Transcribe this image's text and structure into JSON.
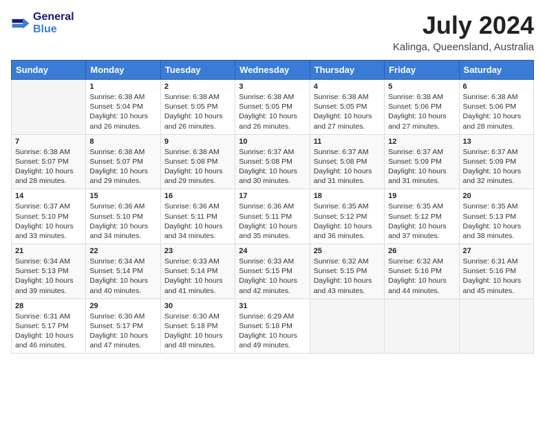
{
  "header": {
    "logo_line1": "General",
    "logo_line2": "Blue",
    "month_year": "July 2024",
    "location": "Kalinga, Queensland, Australia"
  },
  "days_of_week": [
    "Sunday",
    "Monday",
    "Tuesday",
    "Wednesday",
    "Thursday",
    "Friday",
    "Saturday"
  ],
  "weeks": [
    [
      {
        "day": "",
        "info": ""
      },
      {
        "day": "1",
        "info": "Sunrise: 6:38 AM\nSunset: 5:04 PM\nDaylight: 10 hours\nand 26 minutes."
      },
      {
        "day": "2",
        "info": "Sunrise: 6:38 AM\nSunset: 5:05 PM\nDaylight: 10 hours\nand 26 minutes."
      },
      {
        "day": "3",
        "info": "Sunrise: 6:38 AM\nSunset: 5:05 PM\nDaylight: 10 hours\nand 26 minutes."
      },
      {
        "day": "4",
        "info": "Sunrise: 6:38 AM\nSunset: 5:05 PM\nDaylight: 10 hours\nand 27 minutes."
      },
      {
        "day": "5",
        "info": "Sunrise: 6:38 AM\nSunset: 5:06 PM\nDaylight: 10 hours\nand 27 minutes."
      },
      {
        "day": "6",
        "info": "Sunrise: 6:38 AM\nSunset: 5:06 PM\nDaylight: 10 hours\nand 28 minutes."
      }
    ],
    [
      {
        "day": "7",
        "info": "Sunrise: 6:38 AM\nSunset: 5:07 PM\nDaylight: 10 hours\nand 28 minutes."
      },
      {
        "day": "8",
        "info": "Sunrise: 6:38 AM\nSunset: 5:07 PM\nDaylight: 10 hours\nand 29 minutes."
      },
      {
        "day": "9",
        "info": "Sunrise: 6:38 AM\nSunset: 5:08 PM\nDaylight: 10 hours\nand 29 minutes."
      },
      {
        "day": "10",
        "info": "Sunrise: 6:37 AM\nSunset: 5:08 PM\nDaylight: 10 hours\nand 30 minutes."
      },
      {
        "day": "11",
        "info": "Sunrise: 6:37 AM\nSunset: 5:08 PM\nDaylight: 10 hours\nand 31 minutes."
      },
      {
        "day": "12",
        "info": "Sunrise: 6:37 AM\nSunset: 5:09 PM\nDaylight: 10 hours\nand 31 minutes."
      },
      {
        "day": "13",
        "info": "Sunrise: 6:37 AM\nSunset: 5:09 PM\nDaylight: 10 hours\nand 32 minutes."
      }
    ],
    [
      {
        "day": "14",
        "info": "Sunrise: 6:37 AM\nSunset: 5:10 PM\nDaylight: 10 hours\nand 33 minutes."
      },
      {
        "day": "15",
        "info": "Sunrise: 6:36 AM\nSunset: 5:10 PM\nDaylight: 10 hours\nand 34 minutes."
      },
      {
        "day": "16",
        "info": "Sunrise: 6:36 AM\nSunset: 5:11 PM\nDaylight: 10 hours\nand 34 minutes."
      },
      {
        "day": "17",
        "info": "Sunrise: 6:36 AM\nSunset: 5:11 PM\nDaylight: 10 hours\nand 35 minutes."
      },
      {
        "day": "18",
        "info": "Sunrise: 6:35 AM\nSunset: 5:12 PM\nDaylight: 10 hours\nand 36 minutes."
      },
      {
        "day": "19",
        "info": "Sunrise: 6:35 AM\nSunset: 5:12 PM\nDaylight: 10 hours\nand 37 minutes."
      },
      {
        "day": "20",
        "info": "Sunrise: 6:35 AM\nSunset: 5:13 PM\nDaylight: 10 hours\nand 38 minutes."
      }
    ],
    [
      {
        "day": "21",
        "info": "Sunrise: 6:34 AM\nSunset: 5:13 PM\nDaylight: 10 hours\nand 39 minutes."
      },
      {
        "day": "22",
        "info": "Sunrise: 6:34 AM\nSunset: 5:14 PM\nDaylight: 10 hours\nand 40 minutes."
      },
      {
        "day": "23",
        "info": "Sunrise: 6:33 AM\nSunset: 5:14 PM\nDaylight: 10 hours\nand 41 minutes."
      },
      {
        "day": "24",
        "info": "Sunrise: 6:33 AM\nSunset: 5:15 PM\nDaylight: 10 hours\nand 42 minutes."
      },
      {
        "day": "25",
        "info": "Sunrise: 6:32 AM\nSunset: 5:15 PM\nDaylight: 10 hours\nand 43 minutes."
      },
      {
        "day": "26",
        "info": "Sunrise: 6:32 AM\nSunset: 5:16 PM\nDaylight: 10 hours\nand 44 minutes."
      },
      {
        "day": "27",
        "info": "Sunrise: 6:31 AM\nSunset: 5:16 PM\nDaylight: 10 hours\nand 45 minutes."
      }
    ],
    [
      {
        "day": "28",
        "info": "Sunrise: 6:31 AM\nSunset: 5:17 PM\nDaylight: 10 hours\nand 46 minutes."
      },
      {
        "day": "29",
        "info": "Sunrise: 6:30 AM\nSunset: 5:17 PM\nDaylight: 10 hours\nand 47 minutes."
      },
      {
        "day": "30",
        "info": "Sunrise: 6:30 AM\nSunset: 5:18 PM\nDaylight: 10 hours\nand 48 minutes."
      },
      {
        "day": "31",
        "info": "Sunrise: 6:29 AM\nSunset: 5:18 PM\nDaylight: 10 hours\nand 49 minutes."
      },
      {
        "day": "",
        "info": ""
      },
      {
        "day": "",
        "info": ""
      },
      {
        "day": "",
        "info": ""
      }
    ]
  ]
}
